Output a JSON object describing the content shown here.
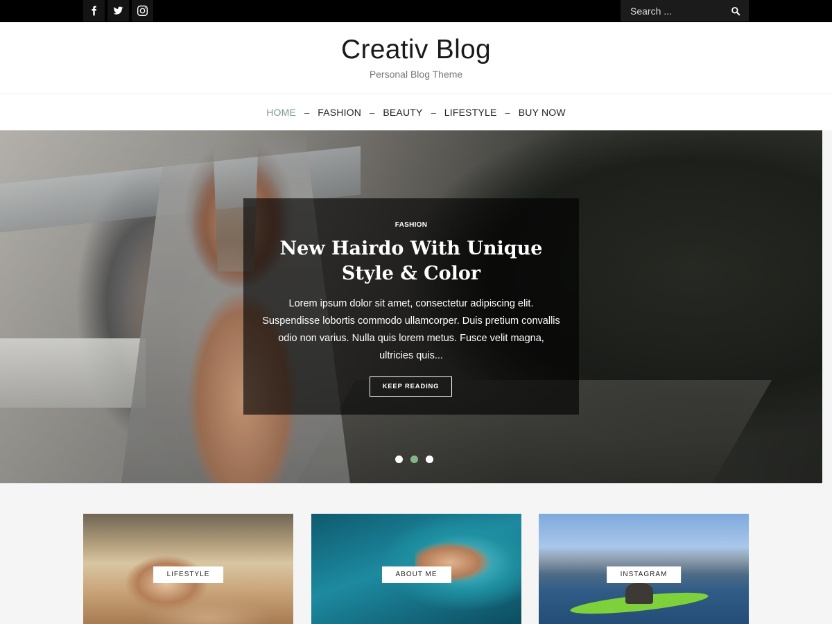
{
  "topbar": {
    "social": [
      {
        "name": "facebook-icon"
      },
      {
        "name": "twitter-icon"
      },
      {
        "name": "instagram-icon"
      }
    ],
    "search_placeholder": "Search ...",
    "search_icon": "search-icon"
  },
  "header": {
    "title": "Creativ Blog",
    "tagline": "Personal Blog Theme"
  },
  "nav": {
    "items": [
      {
        "label": "HOME",
        "active": true
      },
      {
        "label": "FASHION"
      },
      {
        "label": "BEAUTY"
      },
      {
        "label": "LIFESTYLE"
      },
      {
        "label": "BUY NOW"
      }
    ],
    "active_color": "#7a9a89",
    "separator": "–"
  },
  "hero": {
    "category": "FASHION",
    "title": "New Hairdo With Unique Style & Color",
    "excerpt": "Lorem ipsum dolor sit amet, consectetur adipiscing elit. Suspendisse lobortis commodo ullamcorper. Duis pretium convallis odio non varius. Nulla quis lorem metus. Fusce velit magna, ultricies quis...",
    "button_label": "KEEP READING",
    "slides": 3,
    "active_slide": 2,
    "dot_active_color": "#86b487"
  },
  "cards": [
    {
      "label": "LIFESTYLE"
    },
    {
      "label": "ABOUT ME"
    },
    {
      "label": "INSTAGRAM"
    }
  ]
}
